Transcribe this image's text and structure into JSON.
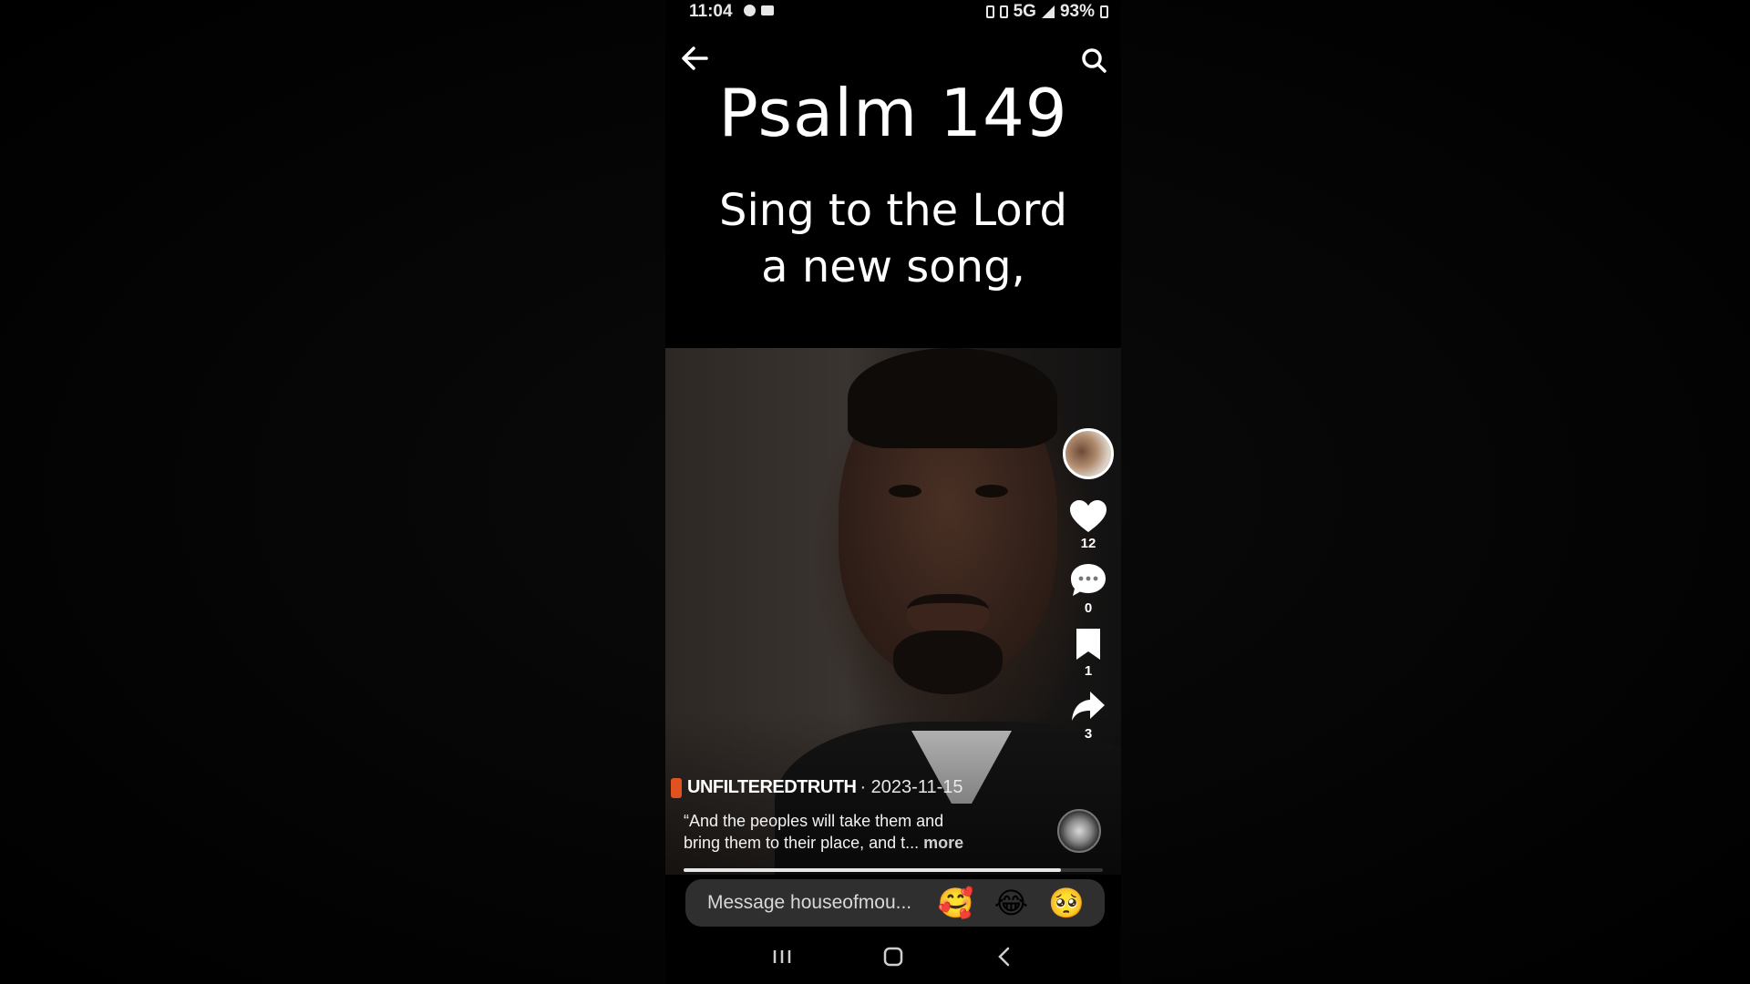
{
  "status_bar": {
    "time": "11:04",
    "network": "5G",
    "battery": "93%"
  },
  "nav": {
    "back_icon": "arrow-left-icon",
    "search_icon": "search-icon"
  },
  "overlay": {
    "title": "Psalm 149",
    "verse_line1": "Sing to the Lord",
    "verse_line2": "a new song,"
  },
  "video": {
    "author": "UNFILTEREDTRUTH",
    "date": "· 2023-11-15",
    "caption_line1": "“And the peoples will take them and",
    "caption_line2": "bring them to their place, and t...",
    "more_label": "more",
    "progress_fraction": 0.9
  },
  "actions": {
    "likes": "12",
    "comments": "0",
    "saves": "1",
    "shares": "3"
  },
  "message_bar": {
    "placeholder": "Message houseofmou...",
    "emojis": [
      "🥰",
      "😂",
      "🥺"
    ]
  },
  "colors": {
    "accent_live": "#e0521f",
    "background": "#000000",
    "text": "#ffffff"
  }
}
